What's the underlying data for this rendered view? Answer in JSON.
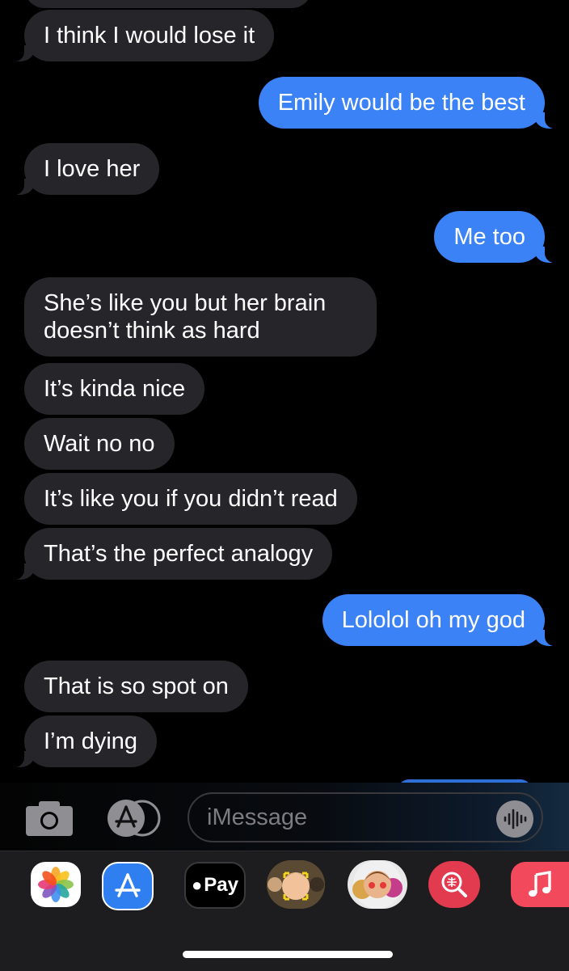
{
  "messages": [
    {
      "id": "m1",
      "dir": "recv",
      "text": "I think I would lose it"
    },
    {
      "id": "m2",
      "dir": "sent",
      "text": "Emily would be the best"
    },
    {
      "id": "m3",
      "dir": "recv",
      "text": "I love her"
    },
    {
      "id": "m4",
      "dir": "sent",
      "text": "Me too"
    },
    {
      "id": "m5",
      "dir": "recv",
      "text": "She’s like you but her brain doesn’t think as hard"
    },
    {
      "id": "m6",
      "dir": "recv",
      "text": "It’s kinda nice"
    },
    {
      "id": "m7",
      "dir": "recv",
      "text": "Wait no no"
    },
    {
      "id": "m8",
      "dir": "recv",
      "text": "It’s like you if you didn’t read"
    },
    {
      "id": "m9",
      "dir": "recv",
      "text": "That’s the perfect analogy"
    },
    {
      "id": "m10",
      "dir": "sent",
      "text": "Lololol oh my god"
    },
    {
      "id": "m11",
      "dir": "recv",
      "text": "That is so spot on"
    },
    {
      "id": "m12",
      "dir": "recv",
      "text": "I’m dying"
    }
  ],
  "input": {
    "placeholder": "iMessage"
  },
  "app_drawer": {
    "apple_pay_label": "Pay",
    "apps": [
      "photos-icon",
      "app-store-icon",
      "apple-pay-icon",
      "memoji-icon",
      "animoji-icon",
      "image-search-icon",
      "music-icon"
    ]
  },
  "colors": {
    "sent": "#3b82f6",
    "received": "#26252a",
    "background": "#000000"
  }
}
